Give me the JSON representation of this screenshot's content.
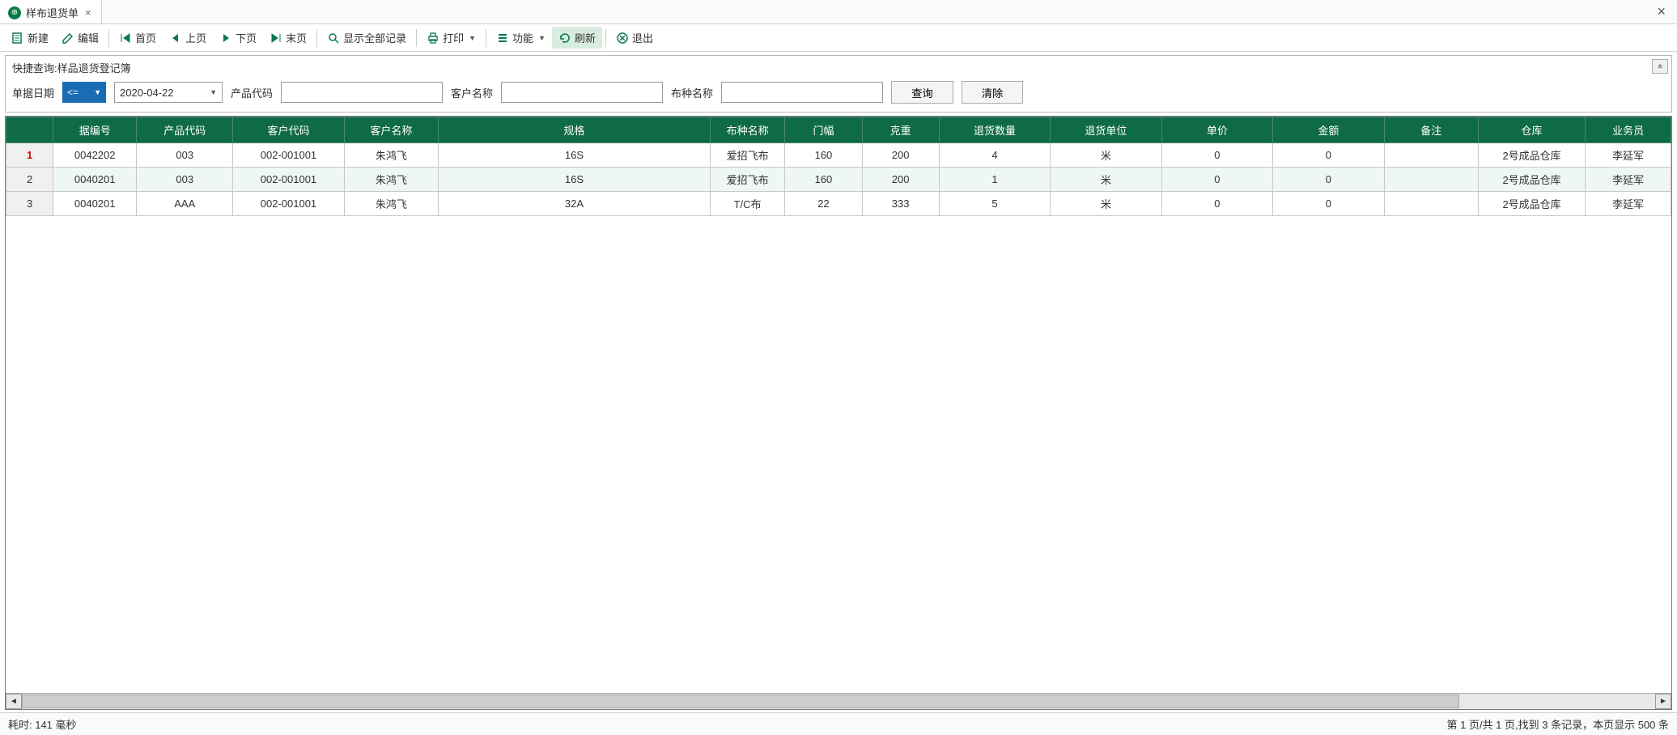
{
  "tab": {
    "title": "样布退货单",
    "close": "×"
  },
  "window": {
    "close": "×"
  },
  "toolbar": {
    "new": "新建",
    "edit": "编辑",
    "first": "首页",
    "prev": "上页",
    "next": "下页",
    "last": "末页",
    "show_all": "显示全部记录",
    "print": "打印",
    "function": "功能",
    "refresh": "刷新",
    "exit": "退出"
  },
  "query": {
    "title": "快捷查询:样品退货登记簿",
    "date_label": "单据日期",
    "op": "<=",
    "date": "2020-04-22",
    "code_label": "产品代码",
    "code_value": "",
    "customer_label": "客户名称",
    "customer_value": "",
    "fabric_label": "布种名称",
    "fabric_value": "",
    "search_btn": "查询",
    "clear_btn": "清除",
    "collapse": "«"
  },
  "columns": [
    "据编号",
    "产品代码",
    "客户代码",
    "客户名称",
    "规格",
    "布种名称",
    "门幅",
    "克重",
    "退货数量",
    "退货单位",
    "单价",
    "金额",
    "备注",
    "仓库",
    "业务员"
  ],
  "rows": [
    {
      "n": "1",
      "sel": true,
      "据编号": "0042202",
      "产品代码": "003",
      "客户代码": "002-001001",
      "客户名称": "朱鸿飞",
      "规格": "16S",
      "布种名称": "爱招飞布",
      "门幅": "160",
      "克重": "200",
      "退货数量": "4",
      "退货单位": "米",
      "单价": "0",
      "金额": "0",
      "备注": "",
      "仓库": "2号成品仓库",
      "业务员": "李延军"
    },
    {
      "n": "2",
      "sel": false,
      "据编号": "0040201",
      "产品代码": "003",
      "客户代码": "002-001001",
      "客户名称": "朱鸿飞",
      "规格": "16S",
      "布种名称": "爱招飞布",
      "门幅": "160",
      "克重": "200",
      "退货数量": "1",
      "退货单位": "米",
      "单价": "0",
      "金额": "0",
      "备注": "",
      "仓库": "2号成品仓库",
      "业务员": "李延军"
    },
    {
      "n": "3",
      "sel": false,
      "据编号": "0040201",
      "产品代码": "AAA",
      "客户代码": "002-001001",
      "客户名称": "朱鸿飞",
      "规格": "32A",
      "布种名称": "T/C布",
      "门幅": "22",
      "克重": "333",
      "退货数量": "5",
      "退货单位": "米",
      "单价": "0",
      "金额": "0",
      "备注": "",
      "仓库": "2号成品仓库",
      "业务员": "李延军"
    }
  ],
  "status": {
    "left": "耗时: 141 毫秒",
    "right": "第 1 页/共 1 页,找到 3 条记录，本页显示 500 条"
  }
}
